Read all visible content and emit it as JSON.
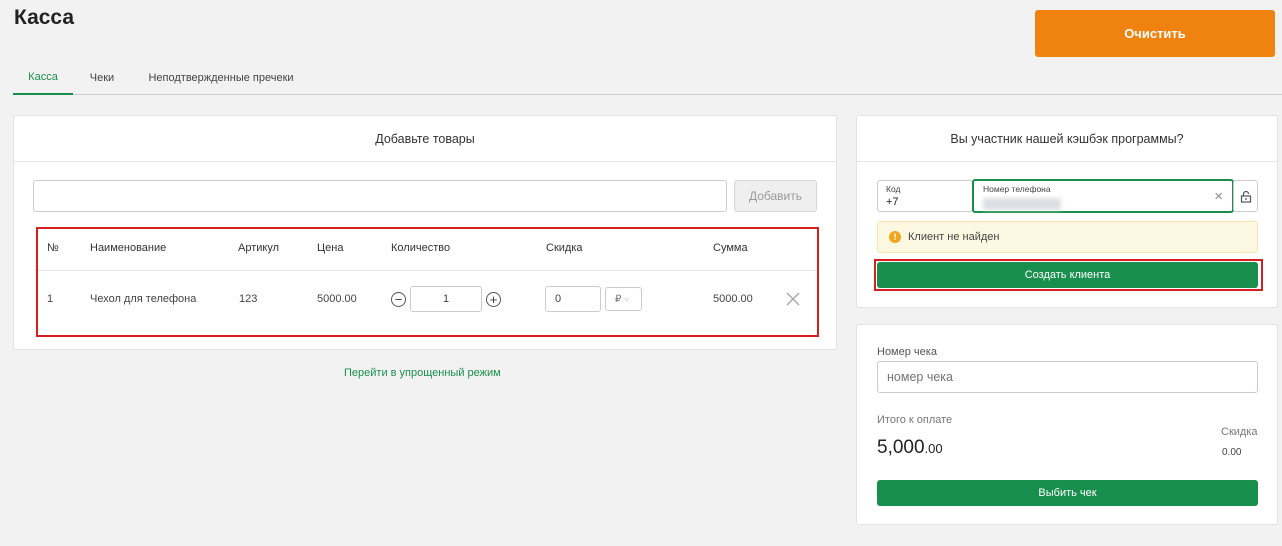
{
  "page": {
    "title": "Касса",
    "clear_label": "Очистить"
  },
  "tabs": [
    {
      "label": "Касса",
      "active": true
    },
    {
      "label": "Чеки",
      "active": false
    },
    {
      "label": "Неподтвержденные пречеки",
      "active": false
    }
  ],
  "products": {
    "heading": "Добавьте товары",
    "search_value": "",
    "add_label": "Добавить",
    "columns": [
      "№",
      "Наименование",
      "Артикул",
      "Цена",
      "Количество",
      "Скидка",
      "Сумма"
    ],
    "rows": [
      {
        "num": "1",
        "name": "Чехол для телефона",
        "article": "123",
        "price": "5000.00",
        "qty": "1",
        "discount": "0",
        "currency": "₽",
        "sum": "5000.00"
      }
    ],
    "simple_mode_link": "Перейти в упрощенный режим"
  },
  "cashback": {
    "heading": "Вы участник нашей кэшбэк программы?",
    "code_label": "Код",
    "code_value": "+7",
    "phone_label": "Номер телефона",
    "notice": "Клиент не найден",
    "create_client": "Создать клиента"
  },
  "receipt": {
    "number_label": "Номер чека",
    "number_placeholder": "номер чека",
    "total_label": "Итого к оплате",
    "total_main": "5,000",
    "total_cents": ".00",
    "discount_label": "Скидка",
    "discount_value": "0.00",
    "print_label": "Выбить чек"
  },
  "colors": {
    "accent": "#198f4e",
    "orange": "#f0820f",
    "alert": "#d42020"
  }
}
